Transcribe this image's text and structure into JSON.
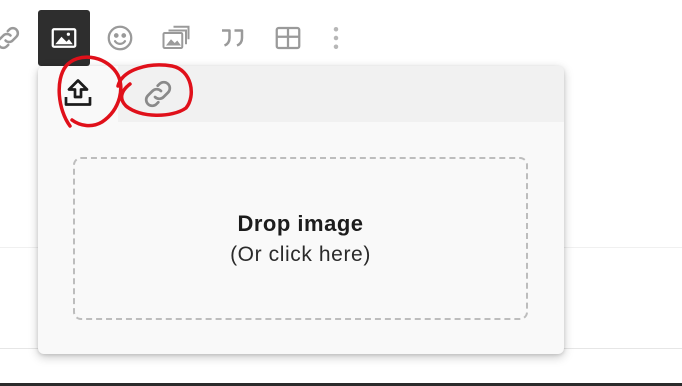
{
  "toolbar": {
    "buttons": [
      {
        "name": "link-icon",
        "active": false
      },
      {
        "name": "image-icon",
        "active": true
      },
      {
        "name": "emoji-icon",
        "active": false
      },
      {
        "name": "gallery-icon",
        "active": false
      },
      {
        "name": "quote-icon",
        "active": false
      },
      {
        "name": "table-icon",
        "active": false
      },
      {
        "name": "more-vertical-icon",
        "active": false
      }
    ]
  },
  "popover": {
    "tabs": [
      {
        "name": "upload-icon",
        "active": true
      },
      {
        "name": "link-icon",
        "active": false
      }
    ],
    "dropzone": {
      "title": "Drop image",
      "subtitle": "(Or click here)"
    }
  },
  "colors": {
    "toolbar_icon": "#9a9a9a",
    "active_button_bg": "#2e2e2e",
    "annotation_red": "#e0101a",
    "dropzone_border": "#bdbdbd",
    "popover_bg": "#f9f9f9"
  }
}
